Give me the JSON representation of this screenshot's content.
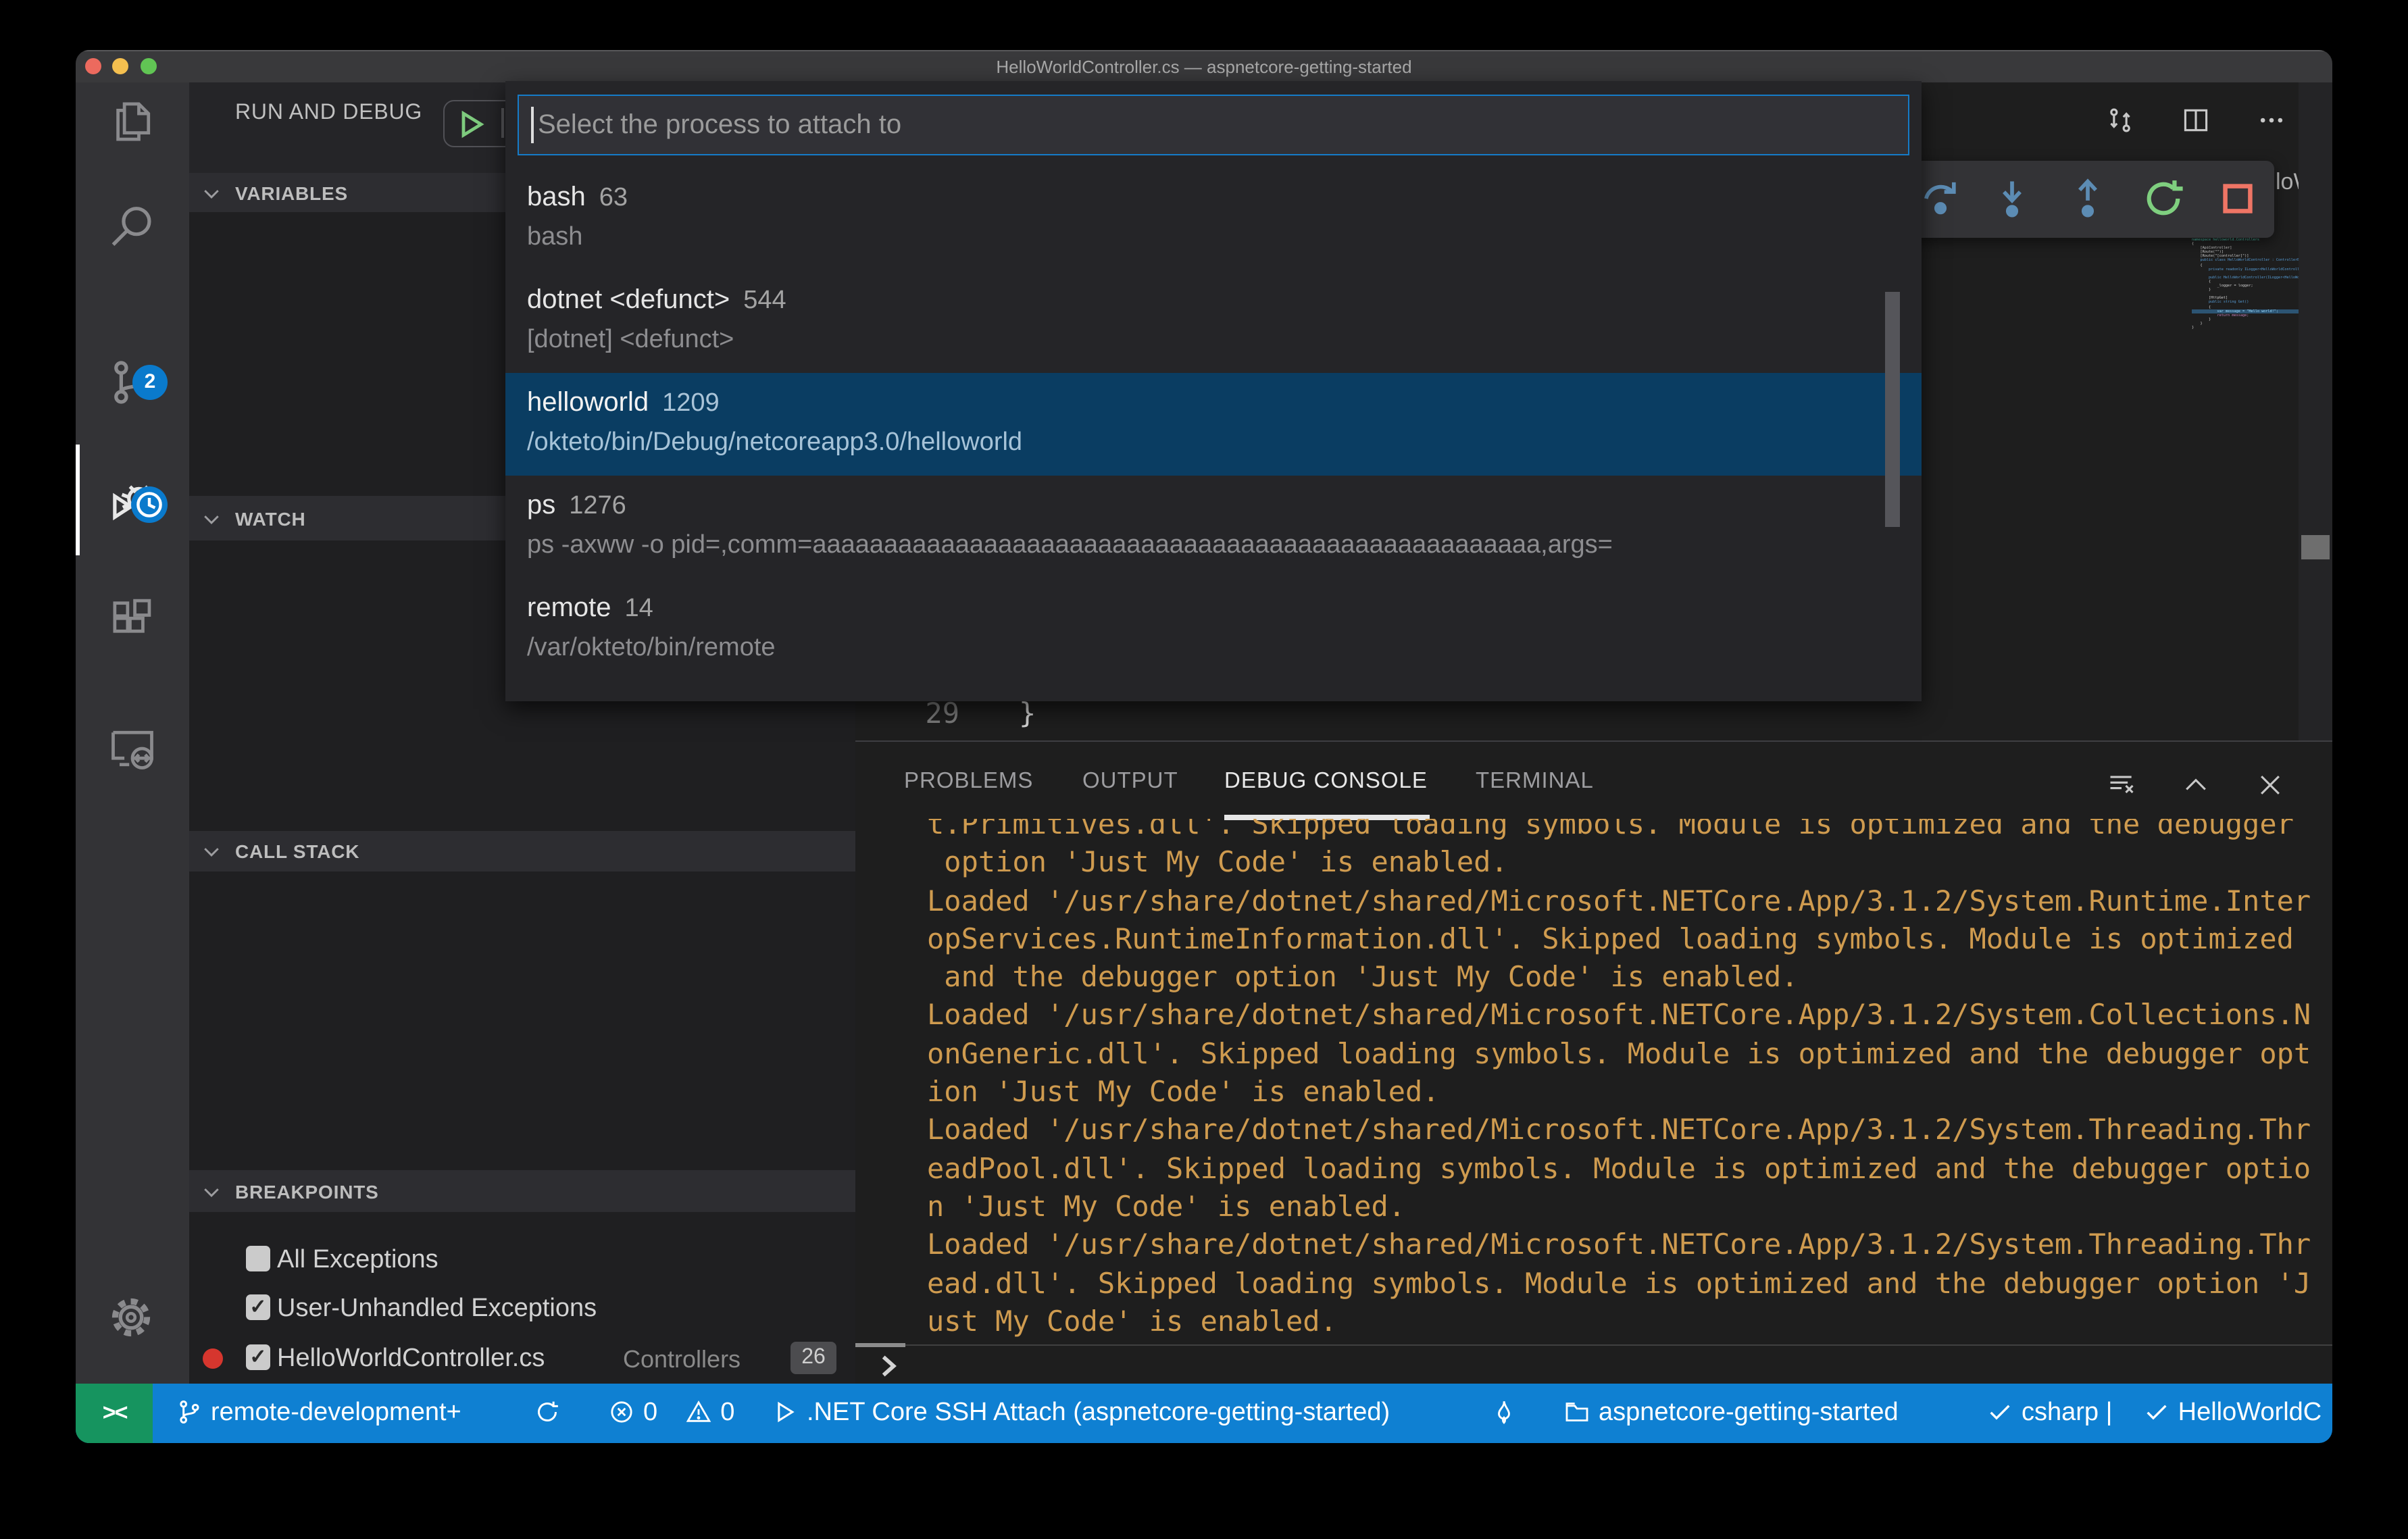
{
  "window": {
    "title": "HelloWorldController.cs — aspnetcore-getting-started"
  },
  "activity_bar": {
    "scm_badge": "2",
    "icons": [
      "explorer-icon",
      "search-icon",
      "source-control-icon",
      "run-and-debug-icon",
      "extensions-icon",
      "remote-explorer-icon",
      "settings-gear-icon"
    ]
  },
  "sidebar": {
    "title": "RUN AND DEBUG",
    "config_fragment": ".",
    "sections": [
      "VARIABLES",
      "WATCH",
      "CALL STACK",
      "BREAKPOINTS"
    ],
    "breakpoints": [
      {
        "label": "All Exceptions",
        "check": ""
      },
      {
        "label": "User-Unhandled Exceptions",
        "check": "✓"
      },
      {
        "label": "HelloWorldController.cs",
        "check": "✓",
        "meta": "Controllers",
        "badge": "26"
      }
    ]
  },
  "quick_pick": {
    "placeholder": "Select the process to attach to",
    "items": [
      {
        "label": "bash",
        "pid": "63",
        "desc": "bash"
      },
      {
        "label": "dotnet <defunct>",
        "pid": "544",
        "desc": "[dotnet] <defunct>"
      },
      {
        "label": "helloworld",
        "pid": "1209",
        "desc": "/okteto/bin/Debug/netcoreapp3.0/helloworld"
      },
      {
        "label": "ps",
        "pid": "1276",
        "desc": "ps -axww -o pid=,comm=aaaaaaaaaaaaaaaaaaaaaaaaaaaaaaaaaaaaaaaaaaaaaaaaaaa,args="
      },
      {
        "label": "remote",
        "pid": "14",
        "desc": "/var/okteto/bin/remote"
      }
    ]
  },
  "debug_toolbar": {
    "icons": [
      "step-over-icon",
      "step-into-icon",
      "step-out-icon",
      "restart-icon",
      "stop-icon"
    ]
  },
  "editor": {
    "tab_fragment": "loWo",
    "line_number": "29",
    "line_code": "}",
    "minimap": [
      {
        "t": "namespace helloworld.Controllers",
        "c": "#4EC9B0"
      },
      {
        "t": "{",
        "c": "#d4d4d4"
      },
      {
        "t": "    [ApiController]",
        "c": "#d4d4d4"
      },
      {
        "t": "    [Route(\"\")]",
        "c": "#d4d4d4"
      },
      {
        "t": "    [Route(\"[controller]\")]",
        "c": "#d4d4d4"
      },
      {
        "t": "    public class HelloWorldController : ControllerBa",
        "c": "#569CD6"
      },
      {
        "t": "    {",
        "c": "#d4d4d4"
      },
      {
        "t": "        private readonly ILogger<HelloWorldControlle",
        "c": "#569CD6"
      },
      {
        "t": "",
        "c": "#d4d4d4"
      },
      {
        "t": "        public HelloWorldController(ILogger<HelloWor",
        "c": "#569CD6"
      },
      {
        "t": "        {",
        "c": "#d4d4d4"
      },
      {
        "t": "            _logger = logger;",
        "c": "#d4d4d4"
      },
      {
        "t": "        }",
        "c": "#d4d4d4"
      },
      {
        "t": "",
        "c": "#d4d4d4"
      },
      {
        "t": "        [HttpGet]",
        "c": "#d4d4d4"
      },
      {
        "t": "        public string Get()",
        "c": "#569CD6"
      },
      {
        "t": "        {",
        "c": "#d4d4d4"
      },
      {
        "t": "            var message = \"Hello world!\";",
        "c": "#9CDCFE"
      },
      {
        "t": "            return message;",
        "c": "#C586C0"
      },
      {
        "t": "        }",
        "c": "#d4d4d4"
      },
      {
        "t": "    }",
        "c": "#d4d4d4"
      },
      {
        "t": "}",
        "c": "#d4d4d4"
      }
    ]
  },
  "panel": {
    "tabs": [
      "PROBLEMS",
      "OUTPUT",
      "DEBUG CONSOLE",
      "TERMINAL"
    ],
    "active_tab": "DEBUG CONSOLE",
    "console_lines": [
      "t.Primitives.dll'. Skipped loading symbols. Module is optimized and the debugger",
      " option 'Just My Code' is enabled.",
      "Loaded '/usr/share/dotnet/shared/Microsoft.NETCore.App/3.1.2/System.Runtime.Inter",
      "opServices.RuntimeInformation.dll'. Skipped loading symbols. Module is optimized",
      " and the debugger option 'Just My Code' is enabled.",
      "Loaded '/usr/share/dotnet/shared/Microsoft.NETCore.App/3.1.2/System.Collections.N",
      "onGeneric.dll'. Skipped loading symbols. Module is optimized and the debugger opt",
      "ion 'Just My Code' is enabled.",
      "Loaded '/usr/share/dotnet/shared/Microsoft.NETCore.App/3.1.2/System.Threading.Thr",
      "eadPool.dll'. Skipped loading symbols. Module is optimized and the debugger optio",
      "n 'Just My Code' is enabled.",
      "Loaded '/usr/share/dotnet/shared/Microsoft.NETCore.App/3.1.2/System.Threading.Thr",
      "ead.dll'. Skipped loading symbols. Module is optimized and the debugger option 'J",
      "ust My Code' is enabled."
    ]
  },
  "status_bar": {
    "remote_glyph": "><",
    "branch": "remote-development+",
    "errors": "0",
    "warnings": "0",
    "debug_status": ".NET Core SSH Attach (aspnetcore-getting-started)",
    "folder": "aspnetcore-getting-started",
    "language": "csharp |",
    "file": "HelloWorldC"
  },
  "colors": {
    "status_blue": "#0f80d2",
    "remote_green": "#16945f",
    "selection_blue": "#0a3d62",
    "console_orange": "#cf9b4f",
    "badge_blue": "#0a7acc"
  }
}
